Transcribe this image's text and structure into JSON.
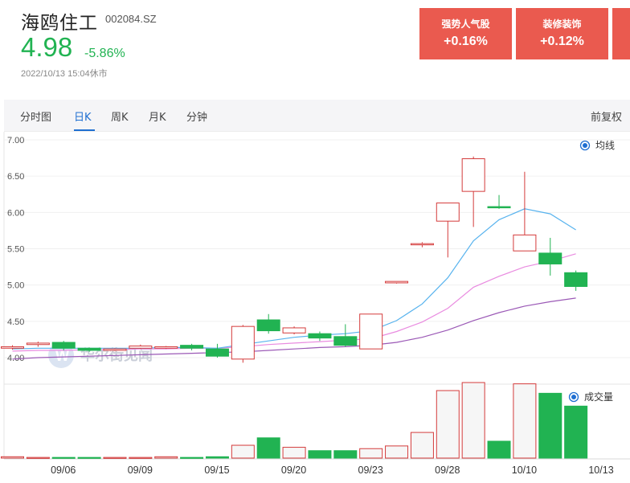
{
  "stock": {
    "name": "海鸥住工",
    "code": "002084.SZ",
    "price": "4.98",
    "change": "-5.86%",
    "timestamp": "2022/10/13 15:04休市"
  },
  "sectors": [
    {
      "name": "强势人气股",
      "change": "+0.16%"
    },
    {
      "name": "装修装饰",
      "change": "+0.12%"
    },
    {
      "name": "",
      "change": ""
    }
  ],
  "tabs": [
    "分时图",
    "日K",
    "周K",
    "月K",
    "分钟"
  ],
  "active_tab": "日K",
  "adjust_label": "前复权",
  "legend": {
    "ma_label": "均线",
    "volume_label": "成交量"
  },
  "watermark": "华尔街见闻",
  "colors": {
    "up": "#d43b3b",
    "down": "#21b352",
    "accent": "#1f6fd1",
    "ma5": "#58b3ee",
    "ma10": "#e98be0",
    "ma20": "#9b59b6"
  },
  "chart_data": [
    {
      "type": "candlestick",
      "yticks": [
        "7.00",
        "6.50",
        "6.00",
        "5.50",
        "5.00",
        "4.50",
        "4.00"
      ],
      "ylim": [
        4.0,
        7.0
      ],
      "xticks": [
        "09/06",
        "09/09",
        "09/15",
        "09/20",
        "09/23",
        "09/28",
        "10/10",
        "10/13"
      ],
      "candles": [
        {
          "o": 4.13,
          "c": 4.15,
          "h": 4.17,
          "l": 4.11
        },
        {
          "o": 4.18,
          "c": 4.2,
          "h": 4.22,
          "l": 4.15
        },
        {
          "o": 4.21,
          "c": 4.13,
          "h": 4.23,
          "l": 4.1
        },
        {
          "o": 4.13,
          "c": 4.1,
          "h": 4.14,
          "l": 4.08
        },
        {
          "o": 4.1,
          "c": 4.12,
          "h": 4.13,
          "l": 4.09
        },
        {
          "o": 4.13,
          "c": 4.16,
          "h": 4.18,
          "l": 4.12
        },
        {
          "o": 4.13,
          "c": 4.15,
          "h": 4.16,
          "l": 4.12
        },
        {
          "o": 4.17,
          "c": 4.13,
          "h": 4.19,
          "l": 4.1
        },
        {
          "o": 4.12,
          "c": 4.02,
          "h": 4.19,
          "l": 4.0
        },
        {
          "o": 3.98,
          "c": 4.43,
          "h": 4.45,
          "l": 3.93
        },
        {
          "o": 4.52,
          "c": 4.37,
          "h": 4.6,
          "l": 4.33
        },
        {
          "o": 4.34,
          "c": 4.41,
          "h": 4.43,
          "l": 4.32
        },
        {
          "o": 4.33,
          "c": 4.27,
          "h": 4.36,
          "l": 4.23
        },
        {
          "o": 4.29,
          "c": 4.17,
          "h": 4.46,
          "l": 4.15
        },
        {
          "o": 4.12,
          "c": 4.6,
          "h": 4.6,
          "l": 4.12
        },
        {
          "o": 5.03,
          "c": 5.05,
          "h": 5.05,
          "l": 5.02
        },
        {
          "o": 5.56,
          "c": 5.57,
          "h": 5.59,
          "l": 5.52
        },
        {
          "o": 5.88,
          "c": 6.13,
          "h": 6.13,
          "l": 5.38
        },
        {
          "o": 6.29,
          "c": 6.74,
          "h": 6.77,
          "l": 5.8
        },
        {
          "o": 6.08,
          "c": 6.07,
          "h": 6.24,
          "l": 6.05
        },
        {
          "o": 5.47,
          "c": 5.69,
          "h": 6.56,
          "l": 5.47
        },
        {
          "o": 5.44,
          "c": 5.29,
          "h": 5.65,
          "l": 5.13
        },
        {
          "o": 5.17,
          "c": 4.98,
          "h": 5.2,
          "l": 4.92
        }
      ],
      "ma5": [
        4.12,
        4.13,
        4.13,
        4.13,
        4.13,
        4.13,
        4.14,
        4.14,
        4.13,
        4.18,
        4.23,
        4.28,
        4.31,
        4.33,
        4.37,
        4.51,
        4.74,
        5.1,
        5.61,
        5.9,
        6.05,
        5.98,
        5.76
      ],
      "ma10": [
        4.09,
        4.1,
        4.1,
        4.11,
        4.11,
        4.12,
        4.12,
        4.13,
        4.13,
        4.15,
        4.18,
        4.2,
        4.22,
        4.24,
        4.26,
        4.36,
        4.49,
        4.68,
        4.97,
        5.12,
        5.25,
        5.33,
        5.43
      ],
      "ma20": [
        3.98,
        4.0,
        4.01,
        4.02,
        4.03,
        4.04,
        4.05,
        4.06,
        4.07,
        4.08,
        4.1,
        4.12,
        4.14,
        4.15,
        4.17,
        4.21,
        4.28,
        4.38,
        4.51,
        4.62,
        4.71,
        4.77,
        4.82
      ]
    },
    {
      "type": "bar",
      "title": "成交量",
      "values": [
        2,
        1,
        1,
        1,
        1,
        1,
        2,
        1,
        2,
        19,
        30,
        16,
        11,
        11,
        14,
        18,
        38,
        100,
        124,
        25,
        110,
        96,
        77
      ]
    }
  ]
}
